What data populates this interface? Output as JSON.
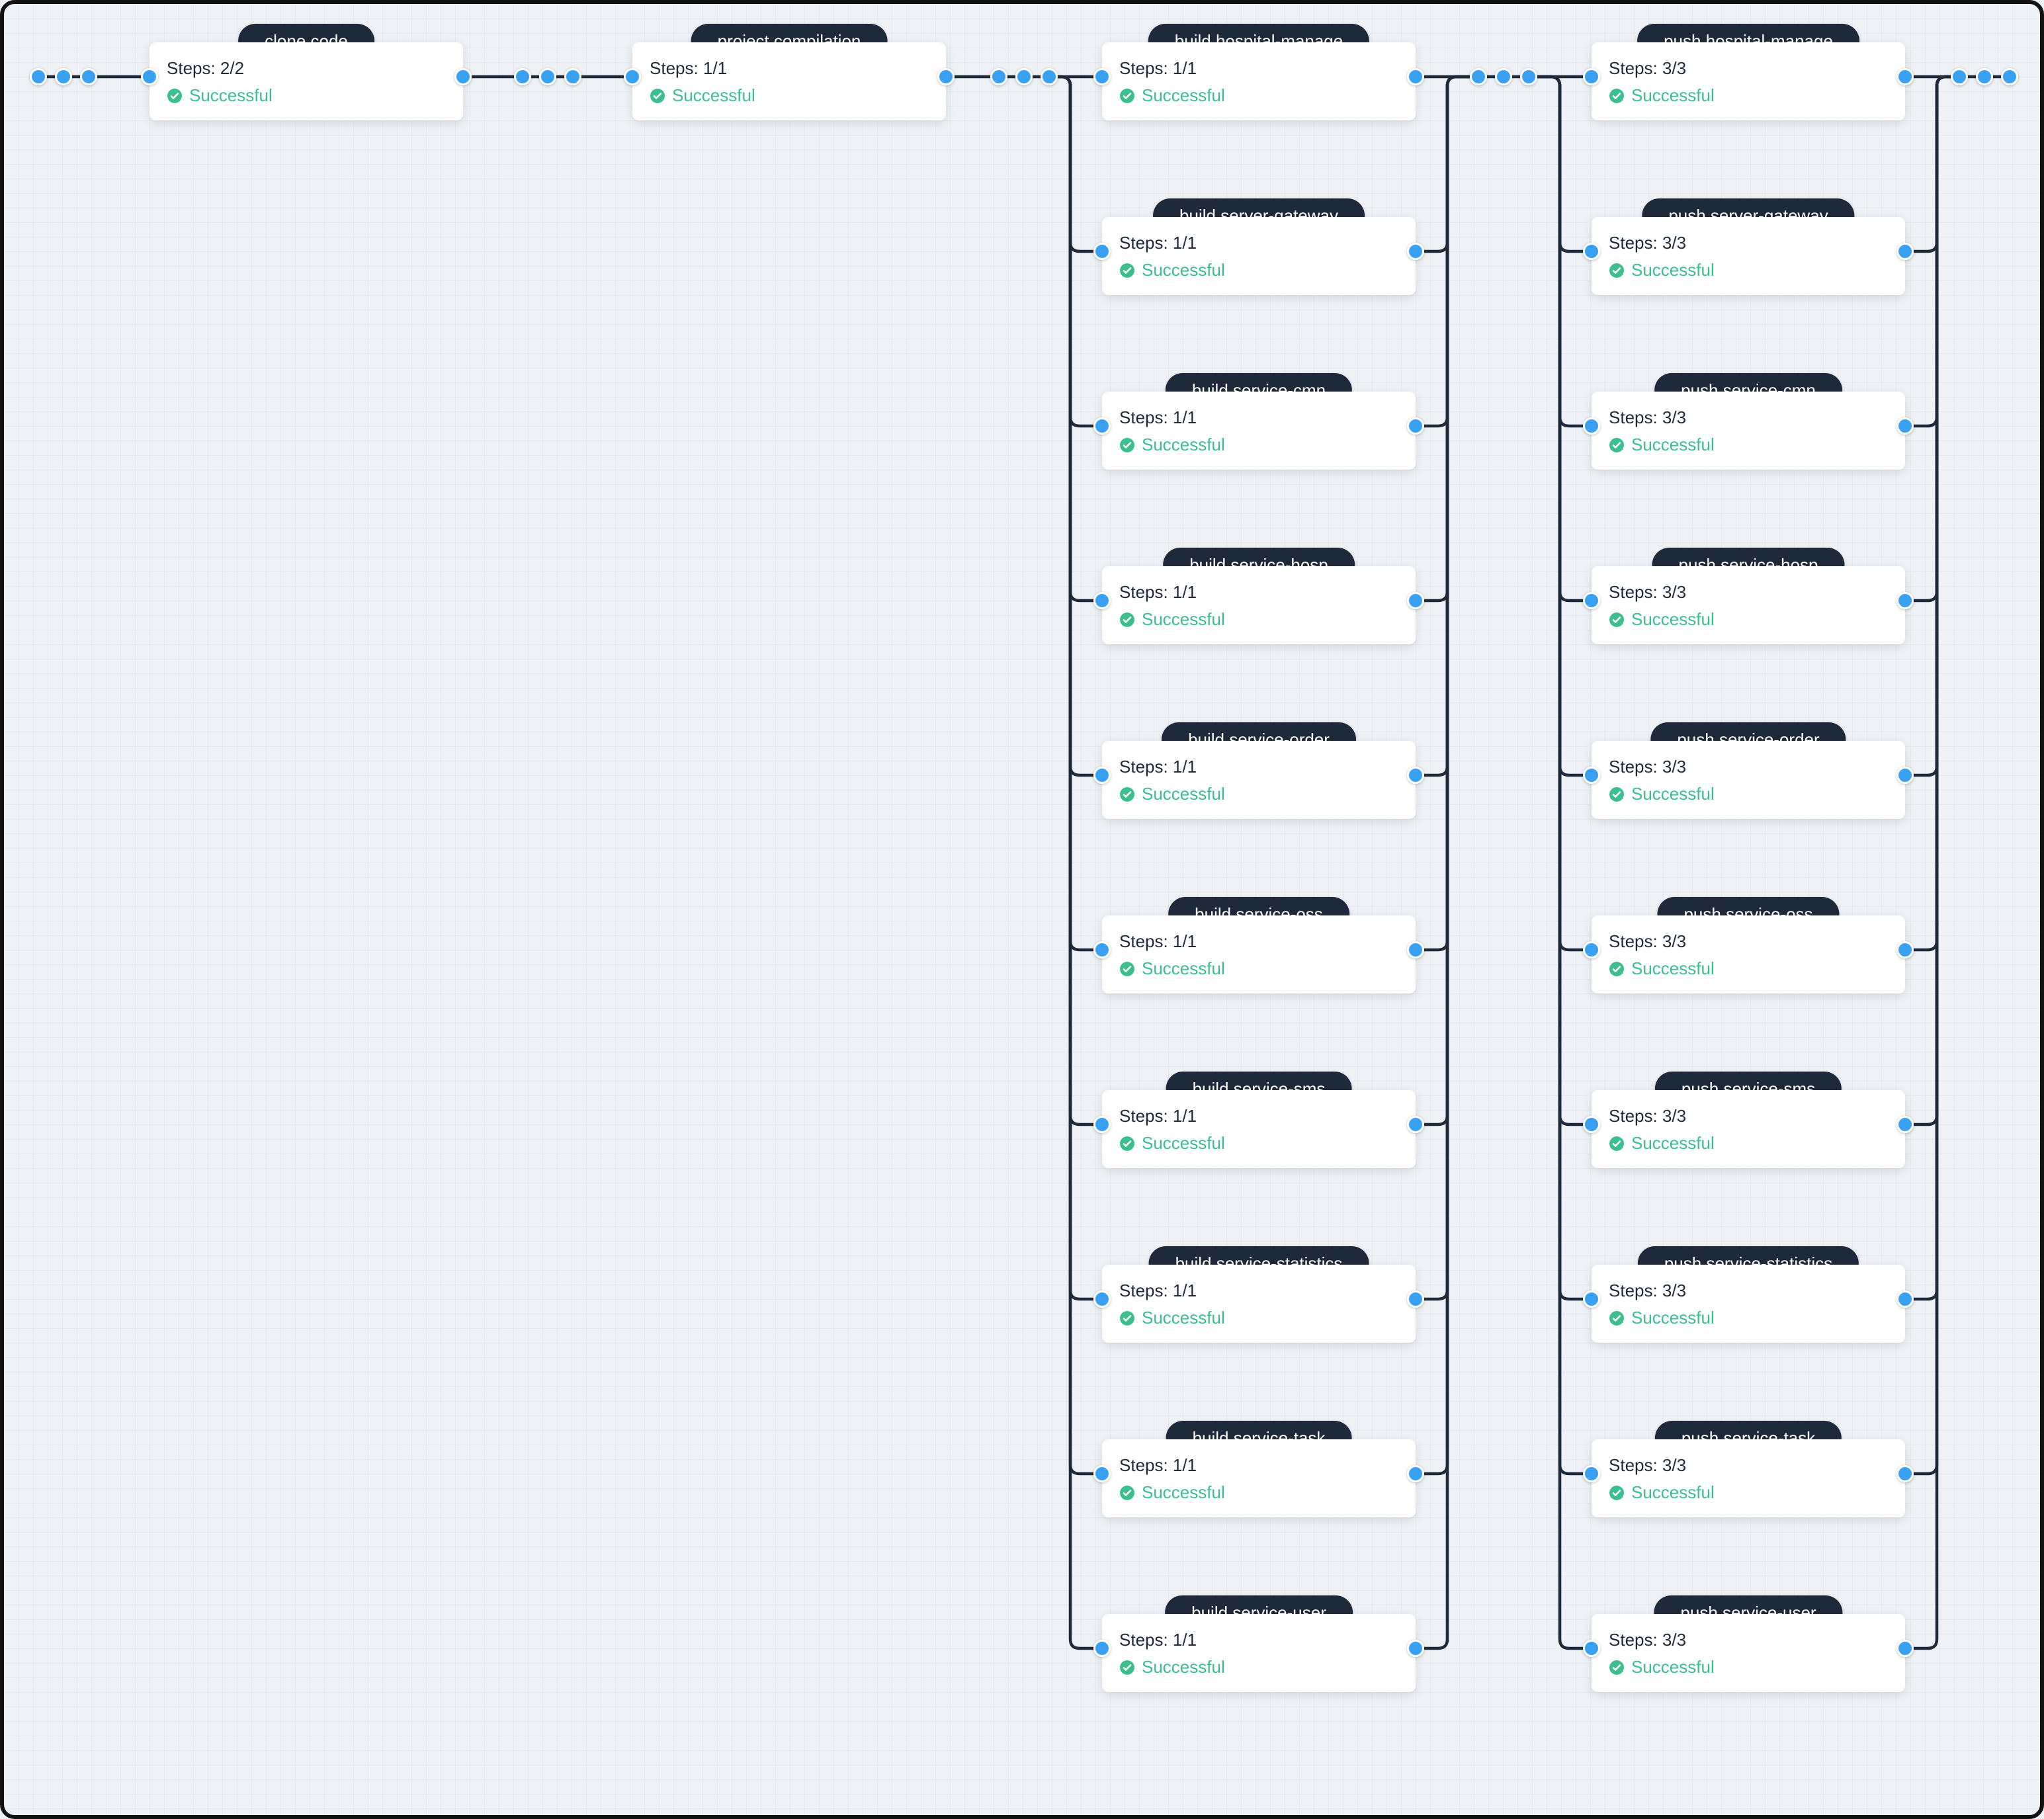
{
  "status_text": "Successful",
  "columns": [
    {
      "stages": [
        {
          "name": "clone code",
          "steps": "Steps: 2/2"
        }
      ]
    },
    {
      "stages": [
        {
          "name": "project compilation",
          "steps": "Steps: 1/1"
        }
      ]
    },
    {
      "stages": [
        {
          "name": "build hospital-manage",
          "steps": "Steps: 1/1"
        },
        {
          "name": "build server-gateway",
          "steps": "Steps: 1/1"
        },
        {
          "name": "build service-cmn",
          "steps": "Steps: 1/1"
        },
        {
          "name": "build service-hosp",
          "steps": "Steps: 1/1"
        },
        {
          "name": "build service-order",
          "steps": "Steps: 1/1"
        },
        {
          "name": "build service-oss",
          "steps": "Steps: 1/1"
        },
        {
          "name": "build service-sms",
          "steps": "Steps: 1/1"
        },
        {
          "name": "build service-statistics",
          "steps": "Steps: 1/1"
        },
        {
          "name": "build service-task",
          "steps": "Steps: 1/1"
        },
        {
          "name": "build service-user",
          "steps": "Steps: 1/1"
        }
      ]
    },
    {
      "stages": [
        {
          "name": "push hospital-manage",
          "steps": "Steps: 3/3"
        },
        {
          "name": "push server-gateway",
          "steps": "Steps: 3/3"
        },
        {
          "name": "push service-cmn",
          "steps": "Steps: 3/3"
        },
        {
          "name": "push service-hosp",
          "steps": "Steps: 3/3"
        },
        {
          "name": "push service-order",
          "steps": "Steps: 3/3"
        },
        {
          "name": "push service-oss",
          "steps": "Steps: 3/3"
        },
        {
          "name": "push service-sms",
          "steps": "Steps: 3/3"
        },
        {
          "name": "push service-statistics",
          "steps": "Steps: 3/3"
        },
        {
          "name": "push service-task",
          "steps": "Steps: 3/3"
        },
        {
          "name": "push service-user",
          "steps": "Steps: 3/3"
        }
      ]
    }
  ]
}
